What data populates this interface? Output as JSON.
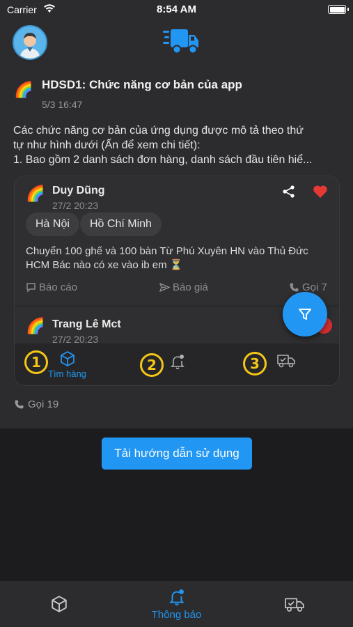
{
  "status_bar": {
    "carrier": "Carrier",
    "time": "8:54 AM"
  },
  "post": {
    "title": "HDSD1: Chức năng cơ bản của app",
    "date": "5/3 16:47",
    "body_lines": [
      "Các chức năng cơ bản của ứng dụng được mô tả theo thứ",
      "tự như hình dưới (Ấn để xem chi tiết):",
      "1. Bao gồm 2 danh sách đơn hàng, danh sách đầu tiên hiể..."
    ],
    "call_label": "Gọi 19"
  },
  "preview": {
    "card1": {
      "name": "Duy Dũng",
      "time": "27/2 20:23",
      "chips": [
        "Hà Nội",
        "Hồ Chí Minh"
      ],
      "message_lines": [
        "Chuyển 100 ghế và 100 bàn Từ Phú Xuyên HN vào Thủ Đức",
        "HCM Bác nào có xe vào ib em ⏳"
      ],
      "actions": {
        "report": "Báo cáo",
        "quote": "Báo giá",
        "call": "Gọi 7"
      }
    },
    "card2": {
      "name": "Trang Lê Mct",
      "time": "27/2 20:23"
    },
    "tabs": {
      "badges": [
        "1",
        "2",
        "3"
      ],
      "find_label": "Tìm hàng"
    }
  },
  "download_button": "Tải hướng dẫn sử dụng",
  "bottom_nav": {
    "active_label": "Thông báo"
  },
  "colors": {
    "accent": "#2196f3",
    "background": "#1c1c1e",
    "surface": "#2c2c2e",
    "heart": "#e53935",
    "badge": "#f5c518"
  }
}
